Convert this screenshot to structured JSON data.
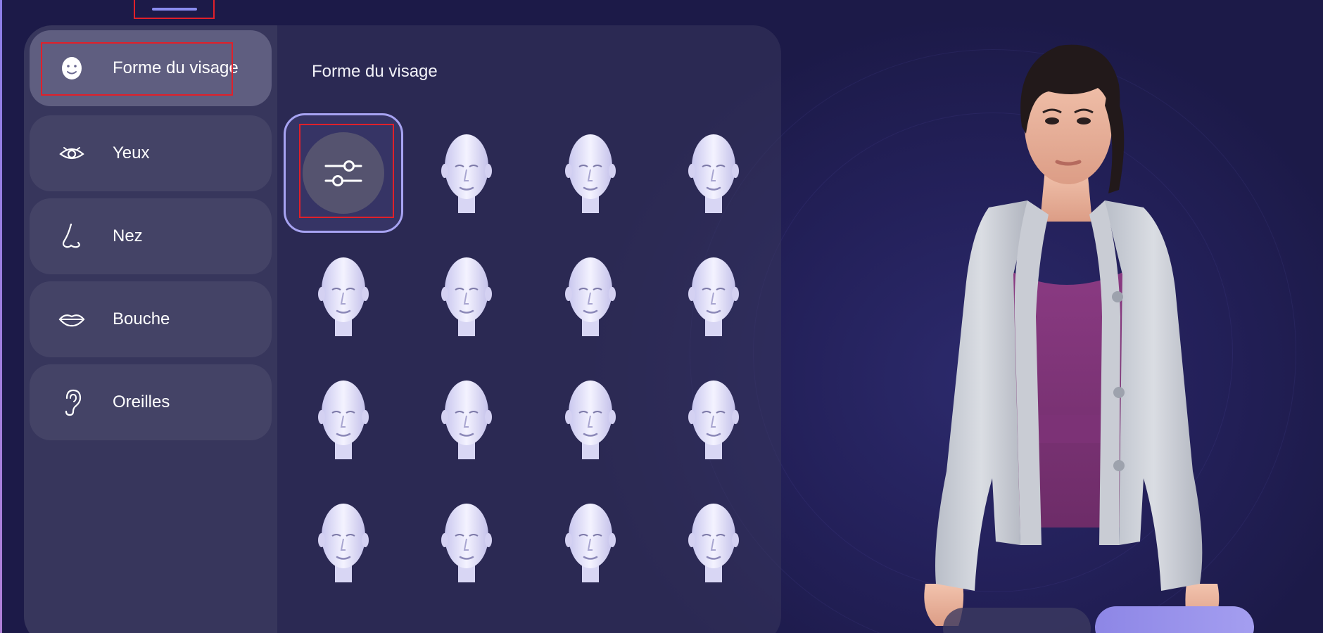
{
  "sidebar": {
    "items": [
      {
        "label": "Forme du visage",
        "icon": "face-icon",
        "active": true
      },
      {
        "label": "Yeux",
        "icon": "eye-icon",
        "active": false
      },
      {
        "label": "Nez",
        "icon": "nose-icon",
        "active": false
      },
      {
        "label": "Bouche",
        "icon": "mouth-icon",
        "active": false
      },
      {
        "label": "Oreilles",
        "icon": "ear-icon",
        "active": false
      }
    ]
  },
  "main": {
    "section_title": "Forme du visage",
    "custom_option_icon": "sliders-icon",
    "preset_count": 15
  },
  "colors": {
    "background": "#1c1a48",
    "accent": "#a7a3f2",
    "highlight": "#e0202a"
  }
}
